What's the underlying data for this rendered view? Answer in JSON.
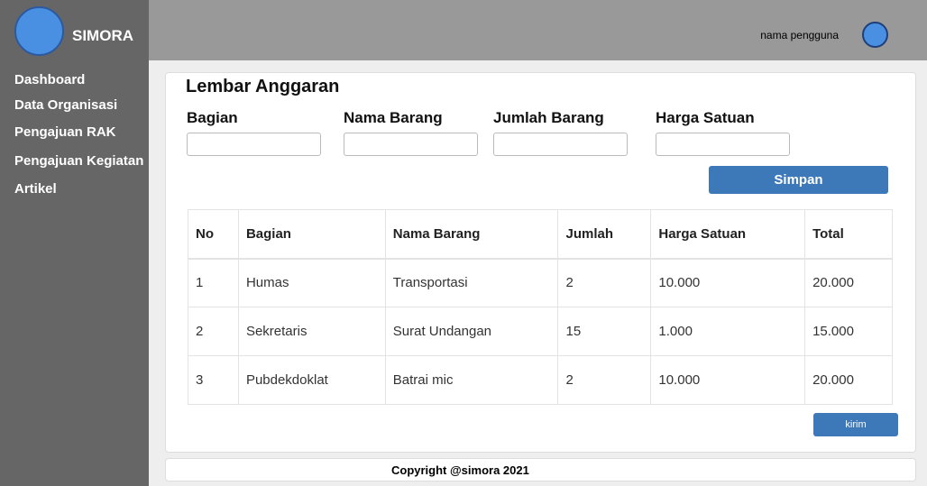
{
  "app": {
    "name": "SIMORA",
    "brand_color": "#4a90e2"
  },
  "sidebar": {
    "items": [
      {
        "label": "Dashboard"
      },
      {
        "label": "Data Organisasi"
      },
      {
        "label": "Pengajuan RAK"
      },
      {
        "label": "Pengajuan Kegiatan"
      },
      {
        "label": "Artikel"
      }
    ]
  },
  "header": {
    "user_name": "nama pengguna"
  },
  "form": {
    "title": "Lembar Anggaran",
    "fields": [
      {
        "label": "Bagian",
        "value": ""
      },
      {
        "label": "Nama Barang",
        "value": ""
      },
      {
        "label": "Jumlah Barang",
        "value": ""
      },
      {
        "label": "Harga Satuan",
        "value": ""
      }
    ],
    "save_label": "Simpan",
    "button_color": "#3d78b8"
  },
  "table": {
    "headers": [
      "No",
      "Bagian",
      "Nama Barang",
      "Jumlah",
      "Harga Satuan",
      "Total"
    ],
    "rows": [
      [
        "1",
        "Humas",
        "Transportasi",
        "2",
        "10.000",
        "20.000"
      ],
      [
        "2",
        "Sekretaris",
        "Surat Undangan",
        "15",
        "1.000",
        "15.000"
      ],
      [
        "3",
        "Pubdekdoklat",
        "Batrai mic",
        "2",
        "10.000",
        "20.000"
      ]
    ]
  },
  "send_label": "kirim",
  "footer": {
    "copyright": "Copyright @simora 2021"
  }
}
